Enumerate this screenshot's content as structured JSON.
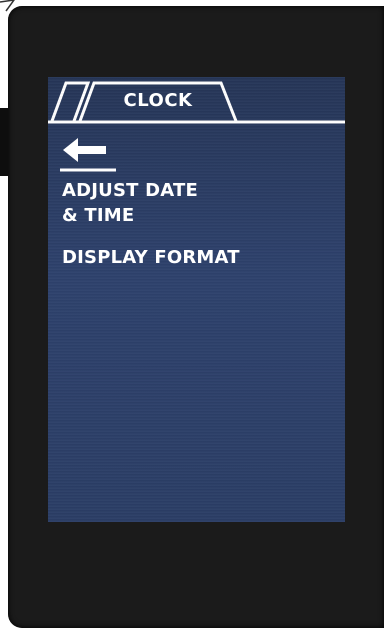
{
  "screen": {
    "tab": {
      "title": "CLOCK"
    },
    "back_icon": "left-arrow-icon",
    "menu": {
      "adjust_line1": "ADJUST DATE",
      "adjust_line2": "& TIME",
      "display_format": "DISPLAY FORMAT"
    }
  },
  "colors": {
    "screen_background": "#2b3e66",
    "text": "#ffffff",
    "bezel": "#1b1b1b"
  }
}
